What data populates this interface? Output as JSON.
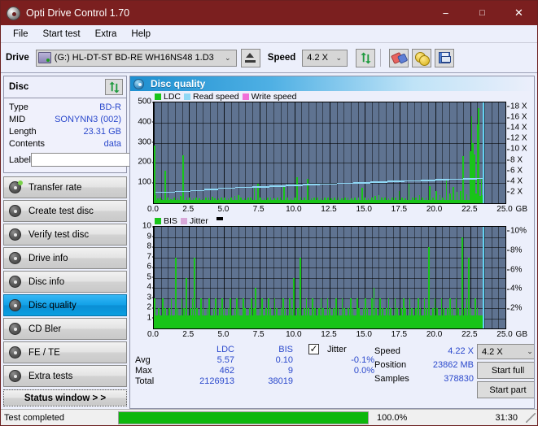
{
  "window": {
    "title": "Opti Drive Control 1.70",
    "icon": "disc-icon",
    "minimize": "−",
    "maximize": "□",
    "close": "✕"
  },
  "menu": {
    "items": [
      "File",
      "Start test",
      "Extra",
      "Help"
    ]
  },
  "toolbar": {
    "drive_label": "Drive",
    "drive_value": "(G:)  HL-DT-ST BD-RE  WH16NS48 1.D3",
    "eject_icon": "eject-icon",
    "speed_label": "Speed",
    "speed_value": "4.2 X",
    "refresh_icon": "refresh-icon",
    "eraser_icon": "eraser-icon",
    "coins_icon": "coins-icon",
    "save_icon": "floppy-save-icon"
  },
  "disc_panel": {
    "title": "Disc",
    "refresh_icon": "refresh-icon",
    "rows": [
      {
        "key": "Type",
        "value": "BD-R"
      },
      {
        "key": "MID",
        "value": "SONYNN3 (002)"
      },
      {
        "key": "Length",
        "value": "23.31 GB"
      },
      {
        "key": "Contents",
        "value": "data"
      }
    ],
    "label_key": "Label",
    "label_value": "",
    "label_placeholder": "",
    "disc_button_icon": "cd-icon"
  },
  "sidebar": {
    "buttons": [
      {
        "label": "Transfer rate",
        "icon": "disc-read-icon",
        "active": false
      },
      {
        "label": "Create test disc",
        "icon": "disc-write-icon",
        "active": false
      },
      {
        "label": "Verify test disc",
        "icon": "disc-verify-icon",
        "active": false
      },
      {
        "label": "Drive info",
        "icon": "drive-info-icon",
        "active": false
      },
      {
        "label": "Disc info",
        "icon": "disc-info-icon",
        "active": false
      },
      {
        "label": "Disc quality",
        "icon": "disc-quality-icon",
        "active": true
      },
      {
        "label": "CD Bler",
        "icon": "cd-bler-icon",
        "active": false
      },
      {
        "label": "FE / TE",
        "icon": "fe-te-icon",
        "active": false
      },
      {
        "label": "Extra tests",
        "icon": "extra-tests-icon",
        "active": false
      }
    ],
    "status_window_button": "Status window > >"
  },
  "main": {
    "header_title": "Disc quality",
    "header_icon": "disc-quality-icon"
  },
  "stats": {
    "columns": [
      "LDC",
      "BIS"
    ],
    "jitter_label": "Jitter",
    "jitter_checked": true,
    "rows": [
      {
        "label": "Avg",
        "ldc": "5.57",
        "bis": "0.10",
        "jitter": "-0.1%"
      },
      {
        "label": "Max",
        "ldc": "462",
        "bis": "9",
        "jitter": "0.0%"
      },
      {
        "label": "Total",
        "ldc": "2126913",
        "bis": "38019",
        "jitter": ""
      }
    ]
  },
  "run_info": {
    "speed_label": "Speed",
    "speed_value": "4.22 X",
    "position_label": "Position",
    "position_value": "23862 MB",
    "samples_label": "Samples",
    "samples_value": "378830",
    "speed_select": "4.2 X",
    "start_full": "Start full",
    "start_part": "Start part"
  },
  "statusbar": {
    "text": "Test completed",
    "percent_text": "100.0%",
    "percent_value": 100,
    "time": "31:30"
  },
  "colors": {
    "ldc": "#19c419",
    "bis": "#19c419",
    "read_speed": "#8fd8f5",
    "write_speed": "#f06fd8",
    "jitter": "#d8a8d8",
    "plot_bg": "#5f7391",
    "accent": "#12a1e8",
    "titlebar": "#7b1f1f",
    "value_text": "#2b49cc",
    "progress": "#0cb70c"
  },
  "chart_data": [
    {
      "id": "ldc-chart",
      "type": "bar",
      "title": "",
      "legend": [
        {
          "label": "LDC",
          "color": "#19c419"
        },
        {
          "label": "Read speed",
          "color": "#8fd8f5"
        },
        {
          "label": "Write speed",
          "color": "#f06fd8"
        }
      ],
      "legend_position": "top-left",
      "xlabel": "GB",
      "ylabel": "LDC",
      "xlim": [
        0,
        25
      ],
      "ylim": [
        0,
        500
      ],
      "xticks": [
        "0.0",
        "2.5",
        "5.0",
        "7.5",
        "10.0",
        "12.5",
        "15.0",
        "17.5",
        "20.0",
        "22.5",
        "25.0"
      ],
      "yticks": [
        100,
        200,
        300,
        400,
        500
      ],
      "y2label": "Speed",
      "y2lim": [
        0,
        18.9
      ],
      "y2ticks": [
        "2 X",
        "4 X",
        "6 X",
        "8 X",
        "10 X",
        "12 X",
        "14 X",
        "16 X",
        "18 X"
      ],
      "grid": true,
      "unit_suffix": "GB",
      "data_end_gb": 23.4,
      "series": [
        {
          "name": "LDC",
          "color": "#19c419",
          "x": [
            0.05,
            0.15,
            0.3,
            0.45,
            0.6,
            0.8,
            1.0,
            1.2,
            1.45,
            1.7,
            1.9,
            2.1,
            2.35,
            2.55,
            2.8,
            3.0,
            3.25,
            3.45,
            3.7,
            3.9,
            4.15,
            4.35,
            4.6,
            4.8,
            5.05,
            5.3,
            5.5,
            5.75,
            6.0,
            6.2,
            6.45,
            6.7,
            6.9,
            7.15,
            7.4,
            7.6,
            7.85,
            8.1,
            8.3,
            8.55,
            8.8,
            9.0,
            9.25,
            9.5,
            9.75,
            10.0,
            10.2,
            10.45,
            10.7,
            10.95,
            11.2,
            11.4,
            11.65,
            11.9,
            12.15,
            12.4,
            12.6,
            12.85,
            13.1,
            13.35,
            13.6,
            13.8,
            14.05,
            14.3,
            14.55,
            14.8,
            15.0,
            15.25,
            15.5,
            15.75,
            16.0,
            16.2,
            16.45,
            16.7,
            16.95,
            17.2,
            17.45,
            17.65,
            17.9,
            18.15,
            18.4,
            18.65,
            18.9,
            19.1,
            19.35,
            19.6,
            19.85,
            20.1,
            20.35,
            20.55,
            20.8,
            21.05,
            21.3,
            21.55,
            21.8,
            22.0,
            22.25,
            22.5,
            22.6,
            22.7,
            22.8,
            22.9,
            23.0,
            23.1,
            23.2,
            23.3,
            23.38
          ],
          "y": [
            285,
            40,
            25,
            30,
            20,
            160,
            28,
            22,
            30,
            25,
            35,
            238,
            30,
            28,
            26,
            30,
            25,
            22,
            28,
            30,
            32,
            26,
            24,
            30,
            28,
            26,
            30,
            35,
            40,
            28,
            26,
            30,
            28,
            80,
            95,
            30,
            25,
            28,
            30,
            26,
            28,
            30,
            80,
            28,
            26,
            30,
            130,
            28,
            30,
            120,
            26,
            28,
            30,
            26,
            30,
            28,
            26,
            30,
            28,
            26,
            30,
            28,
            26,
            30,
            28,
            75,
            30,
            26,
            30,
            35,
            40,
            30,
            28,
            26,
            30,
            28,
            60,
            30,
            26,
            95,
            30,
            28,
            40,
            30,
            28,
            85,
            30,
            60,
            40,
            30,
            120,
            50,
            80,
            55,
            60,
            235,
            45,
            260,
            430,
            300,
            240,
            50,
            390,
            470,
            35,
            120,
            40
          ]
        },
        {
          "name": "Read speed",
          "color": "#8fd8f5",
          "x": [
            0.1,
            1.5,
            2.6,
            3.6,
            4.6,
            5.8,
            7.0,
            8.2,
            9.4,
            10.6,
            11.8,
            13.0,
            14.2,
            15.4,
            16.6,
            17.8,
            19.0,
            20.0,
            21.0,
            22.0,
            23.0,
            23.4
          ],
          "y": [
            2.2,
            2.3,
            2.5,
            2.7,
            2.9,
            3.05,
            3.2,
            3.35,
            3.5,
            3.6,
            3.72,
            3.85,
            3.95,
            4.05,
            4.2,
            4.3,
            4.4,
            4.5,
            4.6,
            4.72,
            4.8,
            4.85
          ],
          "axis": "right",
          "unit": "X"
        },
        {
          "name": "Write speed",
          "color": "#f06fd8",
          "x": [],
          "y": [],
          "axis": "right"
        }
      ]
    },
    {
      "id": "bis-chart",
      "type": "bar",
      "title": "",
      "legend": [
        {
          "label": "BIS",
          "color": "#19c419"
        },
        {
          "label": "Jitter",
          "color": "#d8a8d8"
        }
      ],
      "legend_position": "top-left",
      "xlabel": "GB",
      "ylabel": "BIS",
      "xlim": [
        0,
        25
      ],
      "ylim": [
        0,
        10
      ],
      "xticks": [
        "0.0",
        "2.5",
        "5.0",
        "7.5",
        "10.0",
        "12.5",
        "15.0",
        "17.5",
        "20.0",
        "22.5",
        "25.0"
      ],
      "yticks": [
        1,
        2,
        3,
        4,
        5,
        6,
        7,
        8,
        9,
        10
      ],
      "y2label": "Jitter",
      "y2lim": [
        0,
        10.5
      ],
      "y2ticks": [
        "2%",
        "4%",
        "6%",
        "8%",
        "10%"
      ],
      "grid": true,
      "unit_suffix": "GB",
      "data_end_gb": 23.4,
      "series": [
        {
          "name": "BIS",
          "color": "#19c419",
          "x": [
            0.05,
            0.2,
            0.35,
            0.5,
            0.65,
            0.8,
            0.95,
            1.1,
            1.25,
            1.4,
            1.55,
            1.7,
            1.85,
            2.0,
            2.15,
            2.3,
            2.45,
            2.6,
            2.75,
            2.9,
            3.05,
            3.2,
            3.35,
            3.5,
            3.65,
            3.8,
            3.95,
            4.1,
            4.25,
            4.4,
            4.55,
            4.7,
            4.85,
            5.0,
            5.15,
            5.3,
            5.45,
            5.6,
            5.75,
            5.9,
            6.05,
            6.2,
            6.35,
            6.5,
            6.65,
            6.8,
            6.95,
            7.1,
            7.25,
            7.4,
            7.55,
            7.7,
            7.85,
            8.0,
            8.15,
            8.3,
            8.45,
            8.6,
            8.75,
            8.9,
            9.05,
            9.2,
            9.35,
            9.5,
            9.65,
            9.8,
            9.95,
            10.1,
            10.25,
            10.4,
            10.55,
            10.7,
            10.85,
            11.0,
            11.15,
            11.3,
            11.45,
            11.6,
            11.75,
            11.9,
            12.05,
            12.2,
            12.35,
            12.5,
            12.65,
            12.8,
            12.95,
            13.1,
            13.25,
            13.4,
            13.55,
            13.7,
            13.85,
            14.0,
            14.15,
            14.3,
            14.45,
            14.6,
            14.75,
            14.9,
            15.05,
            15.2,
            15.35,
            15.5,
            15.65,
            15.8,
            15.95,
            16.1,
            16.25,
            16.4,
            16.55,
            16.7,
            16.85,
            17.0,
            17.15,
            17.3,
            17.45,
            17.6,
            17.75,
            17.9,
            18.05,
            18.2,
            18.35,
            18.5,
            18.65,
            18.8,
            18.95,
            19.1,
            19.25,
            19.4,
            19.55,
            19.7,
            19.85,
            20.0,
            20.15,
            20.3,
            20.45,
            20.6,
            20.75,
            20.9,
            21.05,
            21.2,
            21.35,
            21.5,
            21.65,
            21.8,
            21.95,
            22.1,
            22.25,
            22.4,
            22.55,
            22.7,
            22.85,
            23.0,
            23.15,
            23.3
          ],
          "y": [
            3,
            1,
            2,
            1,
            3,
            2,
            1,
            2,
            3,
            1,
            7,
            2,
            1,
            3,
            2,
            5,
            1,
            2,
            3,
            7,
            2,
            1,
            3,
            2,
            1,
            2,
            3,
            1,
            2,
            3,
            1,
            2,
            3,
            2,
            1,
            2,
            3,
            1,
            2,
            3,
            2,
            1,
            3,
            2,
            1,
            2,
            3,
            2,
            4,
            1,
            2,
            3,
            1,
            2,
            3,
            2,
            1,
            3,
            2,
            1,
            2,
            3,
            2,
            1,
            3,
            2,
            5,
            1,
            2,
            7,
            1,
            2,
            3,
            2,
            1,
            3,
            2,
            1,
            2,
            3,
            2,
            1,
            3,
            2,
            1,
            2,
            3,
            2,
            1,
            3,
            2,
            1,
            2,
            3,
            2,
            1,
            3,
            2,
            1,
            2,
            3,
            2,
            1,
            3,
            4,
            2,
            1,
            3,
            2,
            1,
            2,
            3,
            2,
            1,
            3,
            2,
            1,
            2,
            3,
            2,
            1,
            3,
            2,
            1,
            2,
            3,
            2,
            1,
            3,
            2,
            8,
            1,
            2,
            3,
            2,
            1,
            3,
            2,
            1,
            2,
            3,
            2,
            1,
            3,
            2,
            1,
            9,
            2,
            3,
            7,
            2,
            1,
            3,
            2
          ]
        },
        {
          "name": "Jitter",
          "color": "#d8a8d8",
          "x": [],
          "y": [],
          "axis": "right"
        }
      ]
    }
  ]
}
